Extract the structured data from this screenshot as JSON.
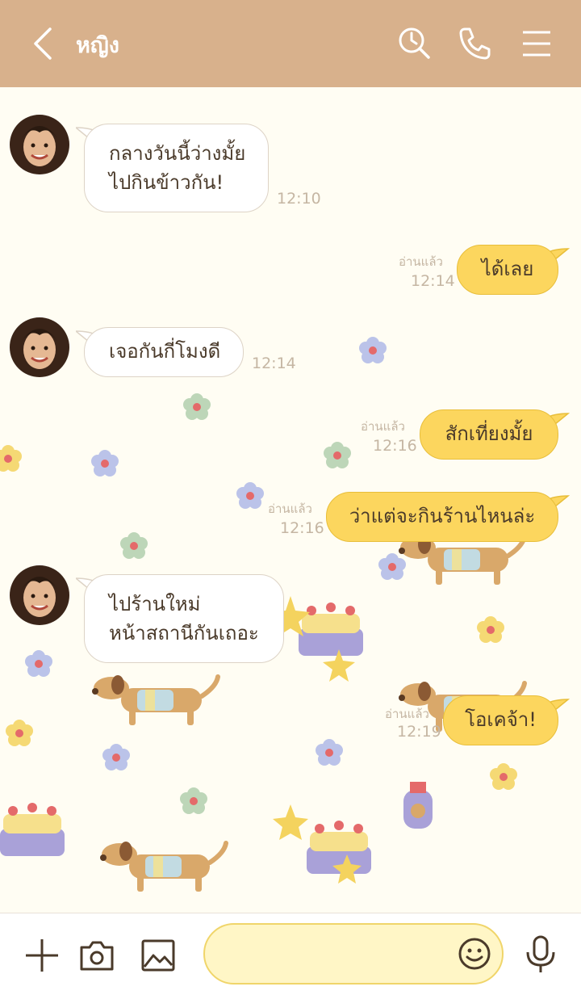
{
  "header": {
    "title": "หญิง",
    "bg_color": "#d8b18c",
    "icons": [
      "back-icon",
      "search-icon",
      "phone-icon",
      "menu-icon"
    ]
  },
  "messages": [
    {
      "id": "m1",
      "direction": "in",
      "text": "กลางวันนี้ว่างมั้ย\nไปกินข้าวกัน!",
      "time": "12:10"
    },
    {
      "id": "m2",
      "direction": "out",
      "text": "ได้เลย",
      "read": "อ่านแล้ว",
      "time": "12:14"
    },
    {
      "id": "m3",
      "direction": "in",
      "text": "เจอกันกี่โมงดี",
      "time": "12:14"
    },
    {
      "id": "m4",
      "direction": "out",
      "text": "สักเที่ยงมั้ย",
      "read": "อ่านแล้ว",
      "time": "12:16"
    },
    {
      "id": "m5",
      "direction": "out",
      "text": "ว่าแต่จะกินร้านไหนล่ะ",
      "read": "อ่านแล้ว",
      "time": "12:16"
    },
    {
      "id": "m6",
      "direction": "in",
      "text": "ไปร้านใหม่\nหน้าสถานีกันเถอะ",
      "time": ""
    },
    {
      "id": "m7",
      "direction": "out",
      "text": "โอเคจ้า!",
      "read": "อ่านแล้ว",
      "time": "12:19"
    }
  ],
  "footer": {
    "input_value": "",
    "icons": [
      "plus-icon",
      "camera-icon",
      "image-icon",
      "emoji-icon",
      "microphone-icon"
    ]
  },
  "colors": {
    "outgoing_bubble": "#fcd65e",
    "incoming_bubble": "#ffffff",
    "chat_bg": "#fffdf3",
    "meta_text": "#c5b6a3"
  }
}
